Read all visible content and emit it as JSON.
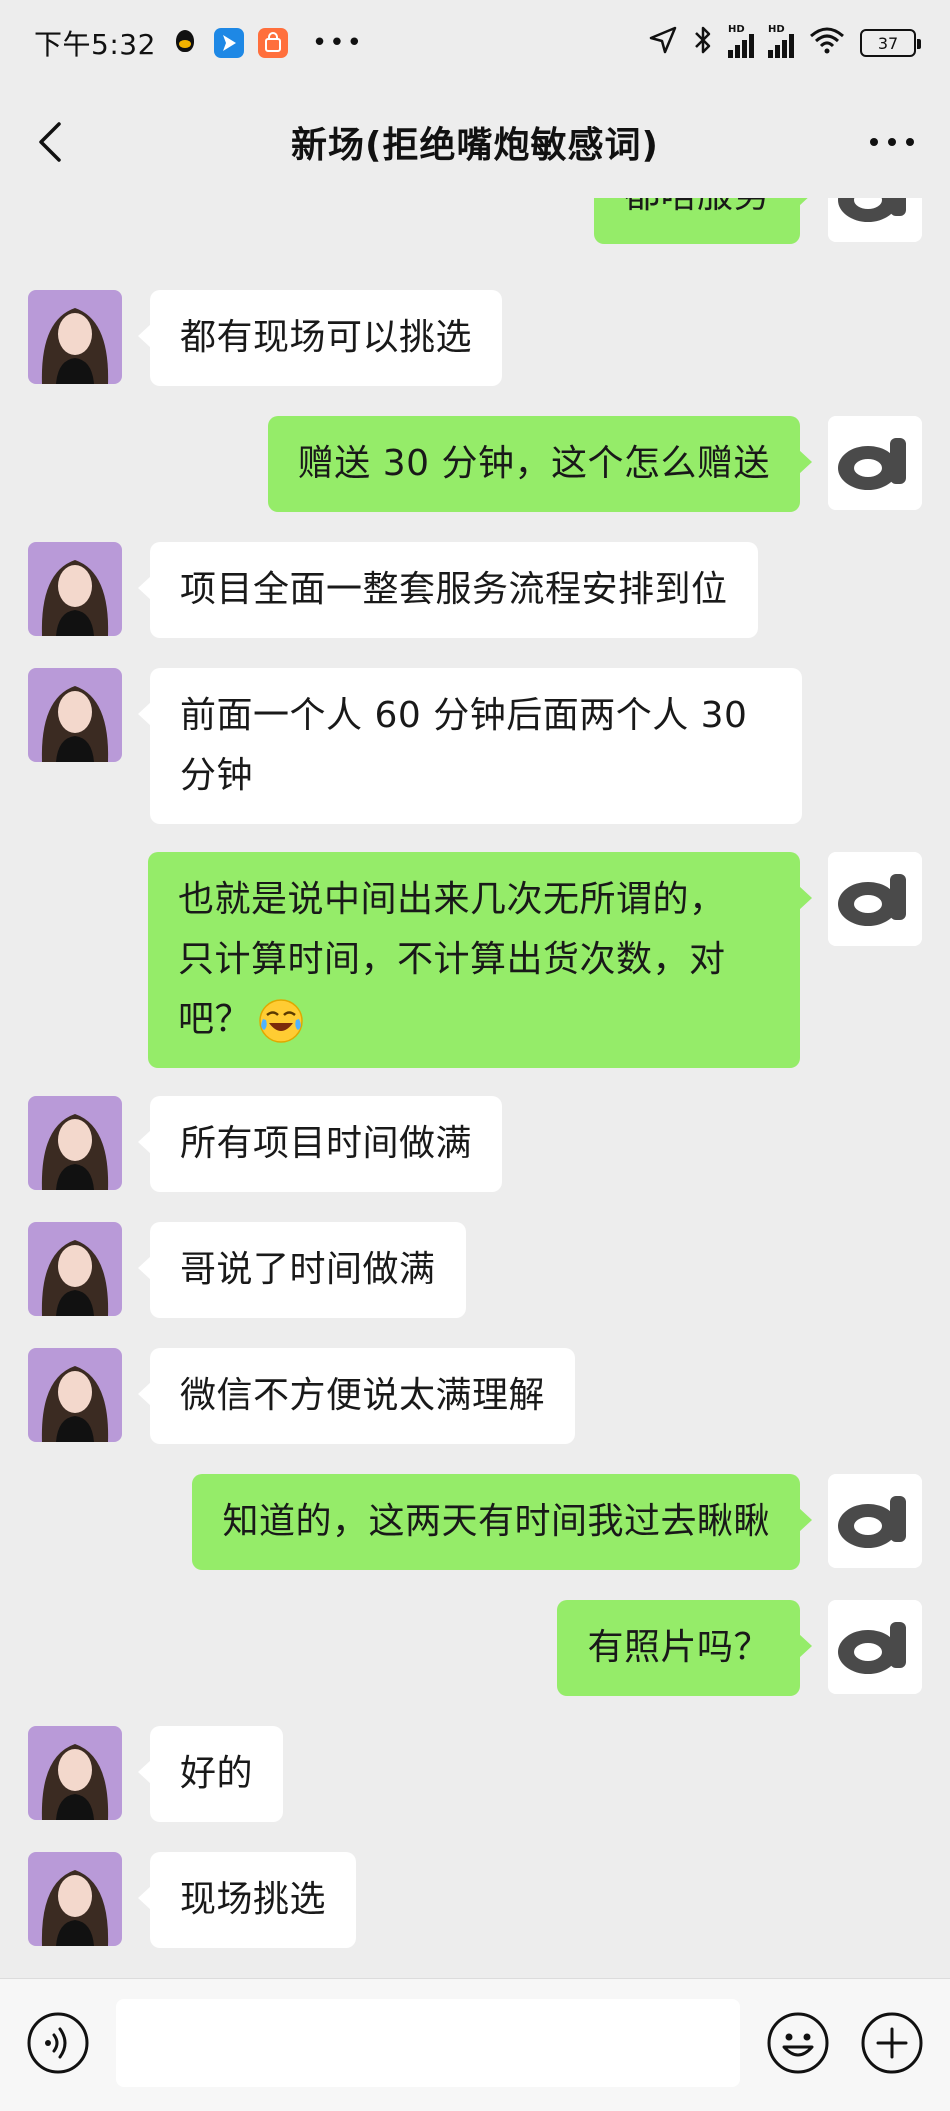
{
  "status_bar": {
    "time": "下午5:32",
    "battery": "37",
    "network_labels": [
      "HD",
      "HD"
    ]
  },
  "nav": {
    "title": "新场(拒绝嘴炮敏感词)"
  },
  "messages": [
    {
      "side": "right",
      "text": "都啥服务"
    },
    {
      "side": "left",
      "text": "都有现场可以挑选"
    },
    {
      "side": "right",
      "text": "赠送 30 分钟，这个怎么赠送"
    },
    {
      "side": "left",
      "text": "项目全面一整套服务流程安排到位"
    },
    {
      "side": "left",
      "text": "前面一个人 60 分钟后面两个人 30\n分钟"
    },
    {
      "side": "right",
      "text": "也就是说中间出来几次无所谓的，\n只计算时间，不计算出货次数，对\n吧？",
      "emoji": "laughing-tears-emoji"
    },
    {
      "side": "left",
      "text": "所有项目时间做满"
    },
    {
      "side": "left",
      "text": "哥说了时间做满"
    },
    {
      "side": "left",
      "text": "微信不方便说太满理解"
    },
    {
      "side": "right",
      "text": "知道的，这两天有时间我过去瞅瞅"
    },
    {
      "side": "right",
      "text": "有照片吗？"
    },
    {
      "side": "left",
      "text": "好的"
    },
    {
      "side": "left",
      "text": "现场挑选"
    }
  ],
  "input_bar": {
    "text_value": "",
    "icons": [
      "voice-icon",
      "emoji-icon",
      "plus-icon"
    ]
  },
  "colors": {
    "background": "#ededed",
    "sent_bubble": "#95ec69",
    "received_bubble": "#ffffff"
  }
}
